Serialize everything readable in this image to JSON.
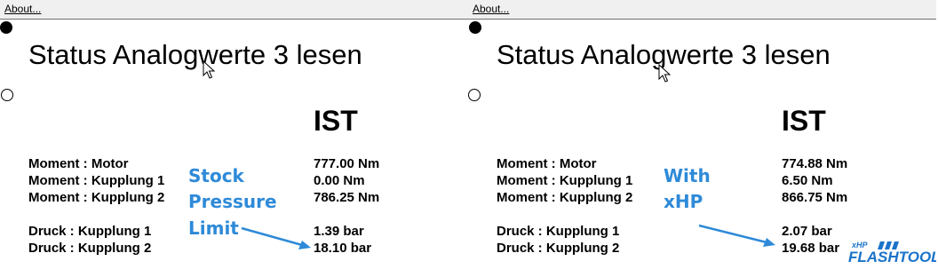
{
  "menu": {
    "about_label": "About..."
  },
  "left": {
    "title": "Status Analogwerte 3 lesen",
    "ist_header": "IST",
    "rows": [
      {
        "label": "Moment : Motor",
        "value": "777.00 Nm"
      },
      {
        "label": "Moment : Kupplung 1",
        "value": "0.00 Nm"
      },
      {
        "label": "Moment : Kupplung 2",
        "value": "786.25 Nm"
      },
      {
        "label": "Druck : Kupplung 1",
        "value": "1.39 bar"
      },
      {
        "label": "Druck : Kupplung 2",
        "value": "18.10 bar"
      }
    ],
    "annotation_lines": [
      "Stock",
      "Pressure",
      "Limit"
    ]
  },
  "right": {
    "title": "Status Analogwerte 3 lesen",
    "ist_header": "IST",
    "rows": [
      {
        "label": "Moment : Motor",
        "value": "774.88 Nm"
      },
      {
        "label": "Moment : Kupplung 1",
        "value": "6.50 Nm"
      },
      {
        "label": "Moment : Kupplung 2",
        "value": "866.75 Nm"
      },
      {
        "label": "Druck : Kupplung 1",
        "value": "2.07 bar"
      },
      {
        "label": "Druck : Kupplung 2",
        "value": "19.68 bar"
      }
    ],
    "annotation_lines": [
      "With",
      "xHP"
    ],
    "logo": {
      "brand": "FLASHTOOL",
      "prefix": "xHP"
    }
  },
  "colors": {
    "annotation": "#2e8ad8",
    "logo": "#1a73c9",
    "menubar": "#f0f0f0"
  }
}
